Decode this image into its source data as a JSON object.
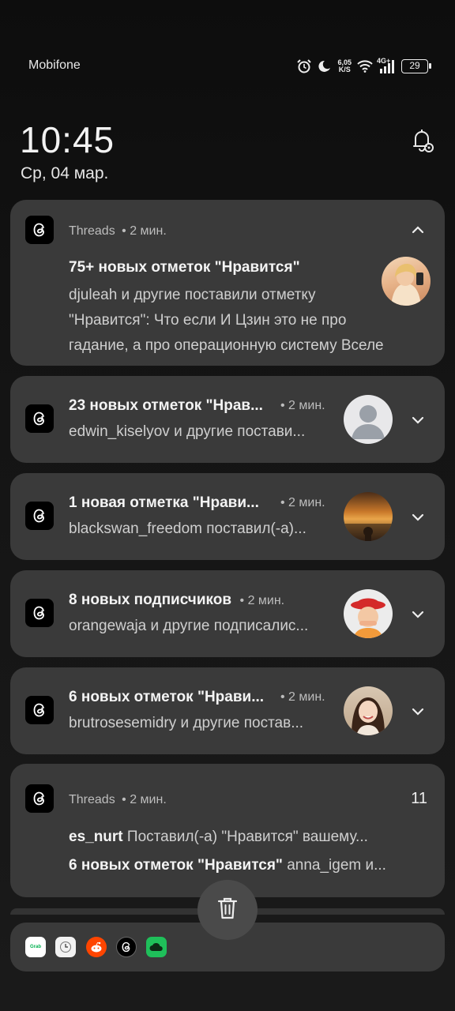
{
  "status": {
    "carrier": "Mobifone",
    "speed_top": "6,05",
    "speed_bottom": "K/S",
    "network": "4G+",
    "battery": "29"
  },
  "lock": {
    "time": "10:45",
    "date": "Ср, 04 мар."
  },
  "notifications": [
    {
      "app": "Threads",
      "time": "• 2 мин.",
      "title": "75+ новых отметок \"Нравится\"",
      "lines": [
        "djuleah и другие поставили отметку",
        "\"Нравится\": Что если И Цзин это не про",
        "гадание, а про операционную систему Вселе"
      ]
    },
    {
      "title": "23 новых отметок \"Нрав...",
      "time": "• 2 мин.",
      "body": "edwin_kiselyov и другие постави..."
    },
    {
      "title": "1 новая отметка \"Нрави...",
      "time": "• 2 мин.",
      "body": "blackswan_freedom поставил(-а)..."
    },
    {
      "title": "8 новых подписчиков",
      "time": "• 2 мин.",
      "body": "orangewaja и другие подписалис..."
    },
    {
      "title": "6 новых отметок \"Нрави...",
      "time": "• 2 мин.",
      "body": "brutrosesemidry и другие постав..."
    },
    {
      "app": "Threads",
      "time": "• 2 мин.",
      "count": "11",
      "line1_user": "es_nurt",
      "line1_text": "Поставил(-а) \"Нравится\" вашему...",
      "line2_title": "6 новых отметок \"Нравится\"",
      "line2_text": "anna_igem и..."
    }
  ],
  "dock": {
    "grab_label": "Grab"
  },
  "colors": {
    "card": "#3a3a3a",
    "background": "#111111"
  }
}
